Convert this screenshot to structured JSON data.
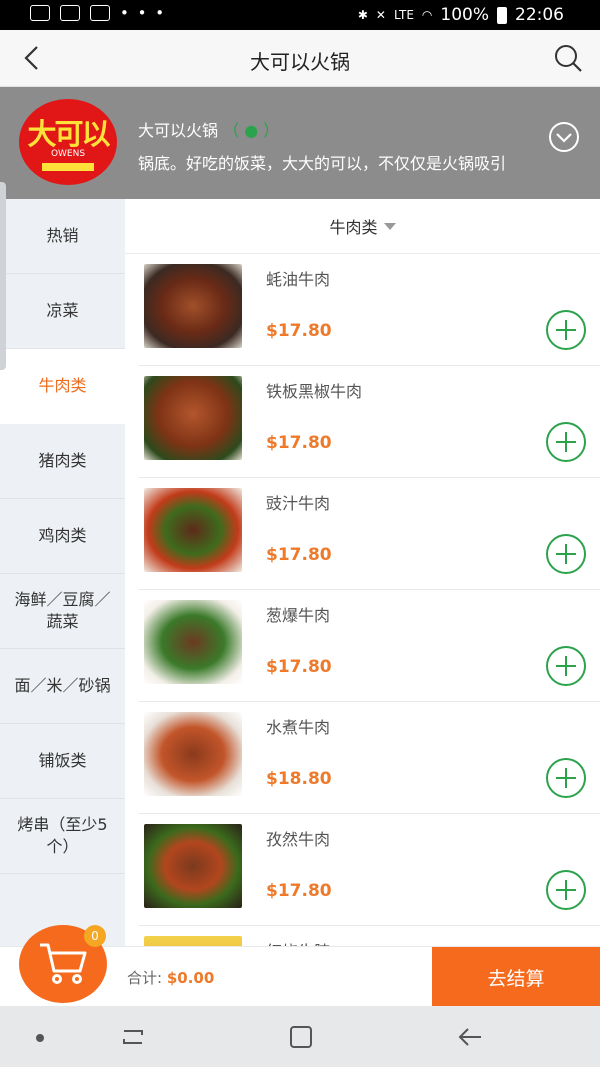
{
  "status_bar": {
    "battery_percent": "100%",
    "time": "22:06",
    "network": "LTE",
    "more_dots": "• • •"
  },
  "nav": {
    "title": "大可以火锅",
    "back_icon": "chevron-left-icon",
    "search_icon": "search-icon"
  },
  "shop": {
    "logo_text": "大可以",
    "logo_sub": "OWENS",
    "name": "大可以火锅",
    "badge": "（ ● ）",
    "description": "锅底。好吃的饭菜，大大的可以，不仅仅是火锅吸引",
    "expand_icon": "chevron-down-circle-icon"
  },
  "categories": [
    {
      "label": "热销"
    },
    {
      "label": "凉菜"
    },
    {
      "label": "牛肉类",
      "active": true
    },
    {
      "label": "猪肉类"
    },
    {
      "label": "鸡肉类"
    },
    {
      "label": "海鲜／豆腐／蔬菜"
    },
    {
      "label": "面／米／砂锅"
    },
    {
      "label": "铺饭类"
    },
    {
      "label": "烤串（至少5个）"
    }
  ],
  "list": {
    "sub_header": "牛肉类",
    "items": [
      {
        "name": "蚝油牛肉",
        "price": "$17.80"
      },
      {
        "name": "铁板黑椒牛肉",
        "price": "$17.80"
      },
      {
        "name": "豉汁牛肉",
        "price": "$17.80"
      },
      {
        "name": "葱爆牛肉",
        "price": "$17.80"
      },
      {
        "name": "水煮牛肉",
        "price": "$18.80"
      },
      {
        "name": "孜然牛肉",
        "price": "$17.80"
      },
      {
        "name": "红烧牛腩",
        "price": ""
      }
    ]
  },
  "cart": {
    "count": "0",
    "total_label": "合计: ",
    "total_value": "$0.00",
    "checkout_label": "去结算"
  },
  "colors": {
    "accent": "#f56a1d",
    "price": "#ee7a2a",
    "add_button": "#2ba24c"
  }
}
